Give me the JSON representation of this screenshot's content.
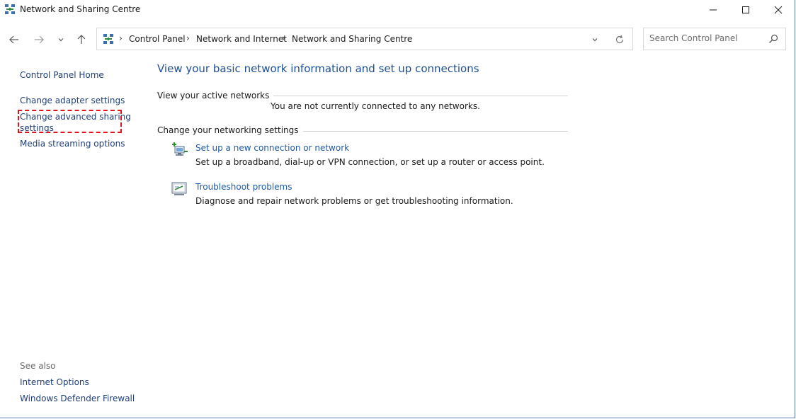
{
  "window": {
    "title": "Network and Sharing Centre",
    "icon": "network-icon",
    "controls": [
      "minimize-icon",
      "maximize-icon",
      "close-icon"
    ]
  },
  "navigation": {
    "back_icon": "arrow-left-icon",
    "forward_icon": "arrow-right-icon",
    "recent_icon": "chevron-down-icon",
    "up_icon": "arrow-up-icon"
  },
  "address_bar": {
    "breadcrumbs": [
      "Control Panel",
      "Network and Internet",
      "Network and Sharing Centre"
    ],
    "separator": "›",
    "dropdown_icon": "chevron-down-icon",
    "refresh_icon": "refresh-icon"
  },
  "search": {
    "placeholder": "Search Control Panel",
    "value": "",
    "icon": "search-icon"
  },
  "sidebar": {
    "home": "Control Panel Home",
    "items": [
      {
        "label": "Change adapter settings"
      },
      {
        "label_line1": "Change advanced sharing",
        "label_line2": "settings"
      },
      {
        "label": "Media streaming options"
      }
    ],
    "highlight_color": "#e0141e",
    "see_also": {
      "heading": "See also",
      "items": [
        "Internet Options",
        "Windows Defender Firewall"
      ]
    }
  },
  "main": {
    "title": "View your basic network information and set up connections",
    "active_networks": {
      "heading": "View your active networks",
      "status": "You are not currently connected to any networks."
    },
    "networking_settings": {
      "heading": "Change your networking settings",
      "tasks": [
        {
          "icon": "new-connection-icon",
          "link": "Set up a new connection or network",
          "description": "Set up a broadband, dial-up or VPN connection, or set up a router or access point."
        },
        {
          "icon": "troubleshoot-icon",
          "link": "Troubleshoot problems",
          "description": "Diagnose and repair network problems or get troubleshooting information."
        }
      ]
    }
  },
  "colors": {
    "link": "#1f3f7a",
    "title": "#1e4e96",
    "highlight": "#e0141e"
  }
}
